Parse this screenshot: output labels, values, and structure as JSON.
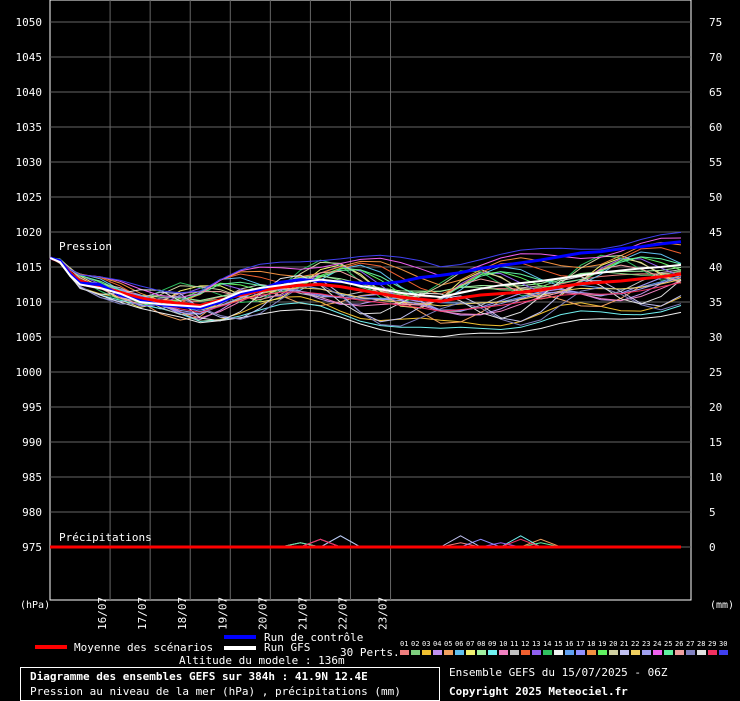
{
  "chart_data": {
    "type": "line",
    "title": "Diagramme des ensembles GEFS sur 384h : 41.9N 12.4E",
    "subtitle": "Pression au niveau de la mer (hPa) , précipitations (mm)",
    "ylabel_left": "(hPa)",
    "ylabel_right": "(mm)",
    "pressure_label": "Pression",
    "precip_label": "Précipitations",
    "ylim_left": [
      970,
      1050
    ],
    "ylim_right": [
      0,
      75
    ],
    "yticks_left": [
      "1050",
      "1045",
      "1040",
      "1035",
      "1030",
      "1025",
      "1020",
      "1015",
      "1010",
      "1005",
      "1000",
      "995",
      "990",
      "985",
      "980",
      "975"
    ],
    "yticks_right": [
      "75",
      "70",
      "65",
      "60",
      "55",
      "50",
      "45",
      "40",
      "35",
      "30",
      "25",
      "20",
      "15",
      "10",
      "5",
      "0"
    ],
    "x_ticks": [
      "16/07",
      "17/07",
      "18/07",
      "19/07",
      "20/07",
      "21/07",
      "22/07",
      "23/07"
    ],
    "x_tick_hours": [
      42,
      66,
      90,
      114,
      138,
      162,
      186,
      210
    ],
    "x_range_hours": [
      6,
      390
    ],
    "grid": true,
    "series": [
      {
        "name": "Moyenne des scénarios",
        "color": "#ff0000",
        "x": [
          6,
          12,
          18,
          24,
          36,
          48,
          60,
          72,
          84,
          96,
          108,
          120,
          132,
          144,
          156,
          168,
          180,
          192,
          204,
          216,
          228,
          240,
          252,
          264,
          276,
          288,
          300,
          312,
          324,
          336,
          348,
          360,
          372,
          384
        ],
        "values": [
          1016.3,
          1015.8,
          1014.2,
          1013.0,
          1012.2,
          1011.4,
          1010.6,
          1010.1,
          1009.8,
          1009.5,
          1010.3,
          1011.0,
          1011.6,
          1012.1,
          1012.4,
          1012.5,
          1012.2,
          1011.7,
          1011.2,
          1010.7,
          1010.4,
          1010.1,
          1010.6,
          1011.0,
          1011.2,
          1011.4,
          1011.7,
          1012.2,
          1012.6,
          1012.8,
          1013.0,
          1013.3,
          1013.6,
          1014.0
        ]
      },
      {
        "name": "Run de contrôle",
        "color": "#0000ff",
        "x": [
          6,
          12,
          18,
          24,
          36,
          48,
          60,
          72,
          84,
          96,
          108,
          120,
          132,
          144,
          156,
          168,
          180,
          192,
          204,
          216,
          228,
          240,
          252,
          264,
          276,
          288,
          300,
          312,
          324,
          336,
          348,
          360,
          372,
          384
        ],
        "values": [
          1016.3,
          1015.9,
          1014.0,
          1012.7,
          1012.5,
          1011.0,
          1010.2,
          1009.6,
          1009.4,
          1009.1,
          1010.0,
          1011.2,
          1011.8,
          1012.8,
          1013.2,
          1013.0,
          1012.9,
          1012.7,
          1012.6,
          1012.9,
          1013.5,
          1013.8,
          1014.2,
          1014.8,
          1015.2,
          1015.6,
          1016.0,
          1016.5,
          1017.0,
          1017.2,
          1017.6,
          1017.9,
          1018.3,
          1018.6
        ]
      },
      {
        "name": "Run GFS",
        "color": "#ffffff",
        "x": [
          6,
          12,
          18,
          24,
          36,
          48,
          60,
          72,
          84,
          96,
          108,
          120,
          132,
          144,
          156,
          168,
          180,
          192,
          204,
          216,
          228,
          240,
          252,
          264,
          276,
          288,
          300,
          312,
          324,
          336,
          348,
          360,
          372,
          384
        ],
        "values": [
          1016.3,
          1015.7,
          1013.8,
          1012.5,
          1012.0,
          1011.2,
          1010.0,
          1009.7,
          1009.5,
          1009.3,
          1010.2,
          1011.4,
          1012.0,
          1012.4,
          1012.8,
          1013.2,
          1012.9,
          1012.3,
          1011.8,
          1011.3,
          1011.0,
          1010.7,
          1011.3,
          1011.9,
          1012.4,
          1012.7,
          1013.0,
          1013.4,
          1013.8,
          1014.2,
          1014.5,
          1014.8,
          1015.0,
          1015.3
        ]
      },
      {
        "name": "Précipitations",
        "color": "#ff0000",
        "axis": "right",
        "x": [
          6,
          384
        ],
        "values": [
          0,
          0
        ]
      }
    ]
  },
  "legend": {
    "mean_label": "Moyenne des scénarios",
    "control_label": "Run de contrôle",
    "gfs_label": "Run GFS",
    "altitude": "Altitude du modele : 136m",
    "perts_label": "30 Perts.",
    "pert_numbers": [
      "01",
      "02",
      "03",
      "04",
      "05",
      "06",
      "07",
      "08",
      "09",
      "10",
      "11",
      "12",
      "13",
      "14",
      "15",
      "16",
      "17",
      "18",
      "19",
      "20",
      "21",
      "22",
      "23",
      "24",
      "25",
      "26",
      "27",
      "28",
      "29",
      "30"
    ],
    "pert_colors": [
      "#f07f7f",
      "#7fd07f",
      "#f0c030",
      "#c090f0",
      "#f0a060",
      "#60c0f0",
      "#f0f070",
      "#a0f0a0",
      "#70f0f0",
      "#f080c0",
      "#c0c0c0",
      "#f06030",
      "#9060f0",
      "#30c060",
      "#f0f0f0",
      "#60a0f0",
      "#9090ff",
      "#f09040",
      "#60f060",
      "#d0d0a0",
      "#c0c0f0",
      "#f0d060",
      "#a0a0f0",
      "#f060f0",
      "#60f0a0",
      "#f0a0a0",
      "#8080c0",
      "#e0e0e0",
      "#f03060",
      "#4040f0"
    ],
    "run_info": "Ensemble GEFS du 15/07/2025 - 06Z",
    "copyright": "Copyright 2025 Meteociel.fr"
  }
}
